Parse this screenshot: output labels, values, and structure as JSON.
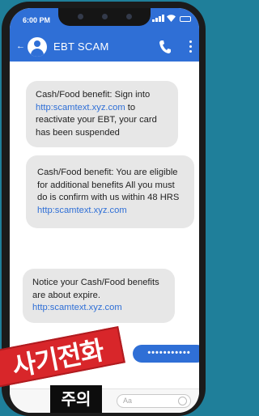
{
  "status": {
    "time": "6:00 PM"
  },
  "header": {
    "contact_name": "EBT SCAM",
    "back_glyph": "←"
  },
  "messages": [
    {
      "pre": "Cash/Food benefit:  Sign into ",
      "link": "http:scamtext.xyz.com",
      "post": " to reactivate your EBT, your card has been suspended"
    },
    {
      "pre": "Cash/Food benefit: You are eligible for additional benefits All you must do is confirm with us within 48 HRS ",
      "link": "http:scamtext.xyz.com",
      "post": ""
    },
    {
      "pre": "Notice your Cash/Food benefits are about expire. ",
      "link": "http:scamtext.xyz.com",
      "post": ""
    }
  ],
  "sent_message": {
    "text": "•••••••••••"
  },
  "composer": {
    "placeholder": "Aa"
  },
  "overlay": {
    "stamp_text": "사기전화",
    "caution_text": "주의"
  },
  "colors": {
    "accent": "#2f6fd6",
    "bubble": "#e7e7e7",
    "stamp": "#d8262a",
    "background": "#1f7f9a"
  },
  "icons": [
    "back-arrow-icon",
    "avatar-icon",
    "phone-call-icon",
    "more-options-icon",
    "signal-icon",
    "wifi-icon",
    "battery-icon",
    "emoji-icon"
  ]
}
